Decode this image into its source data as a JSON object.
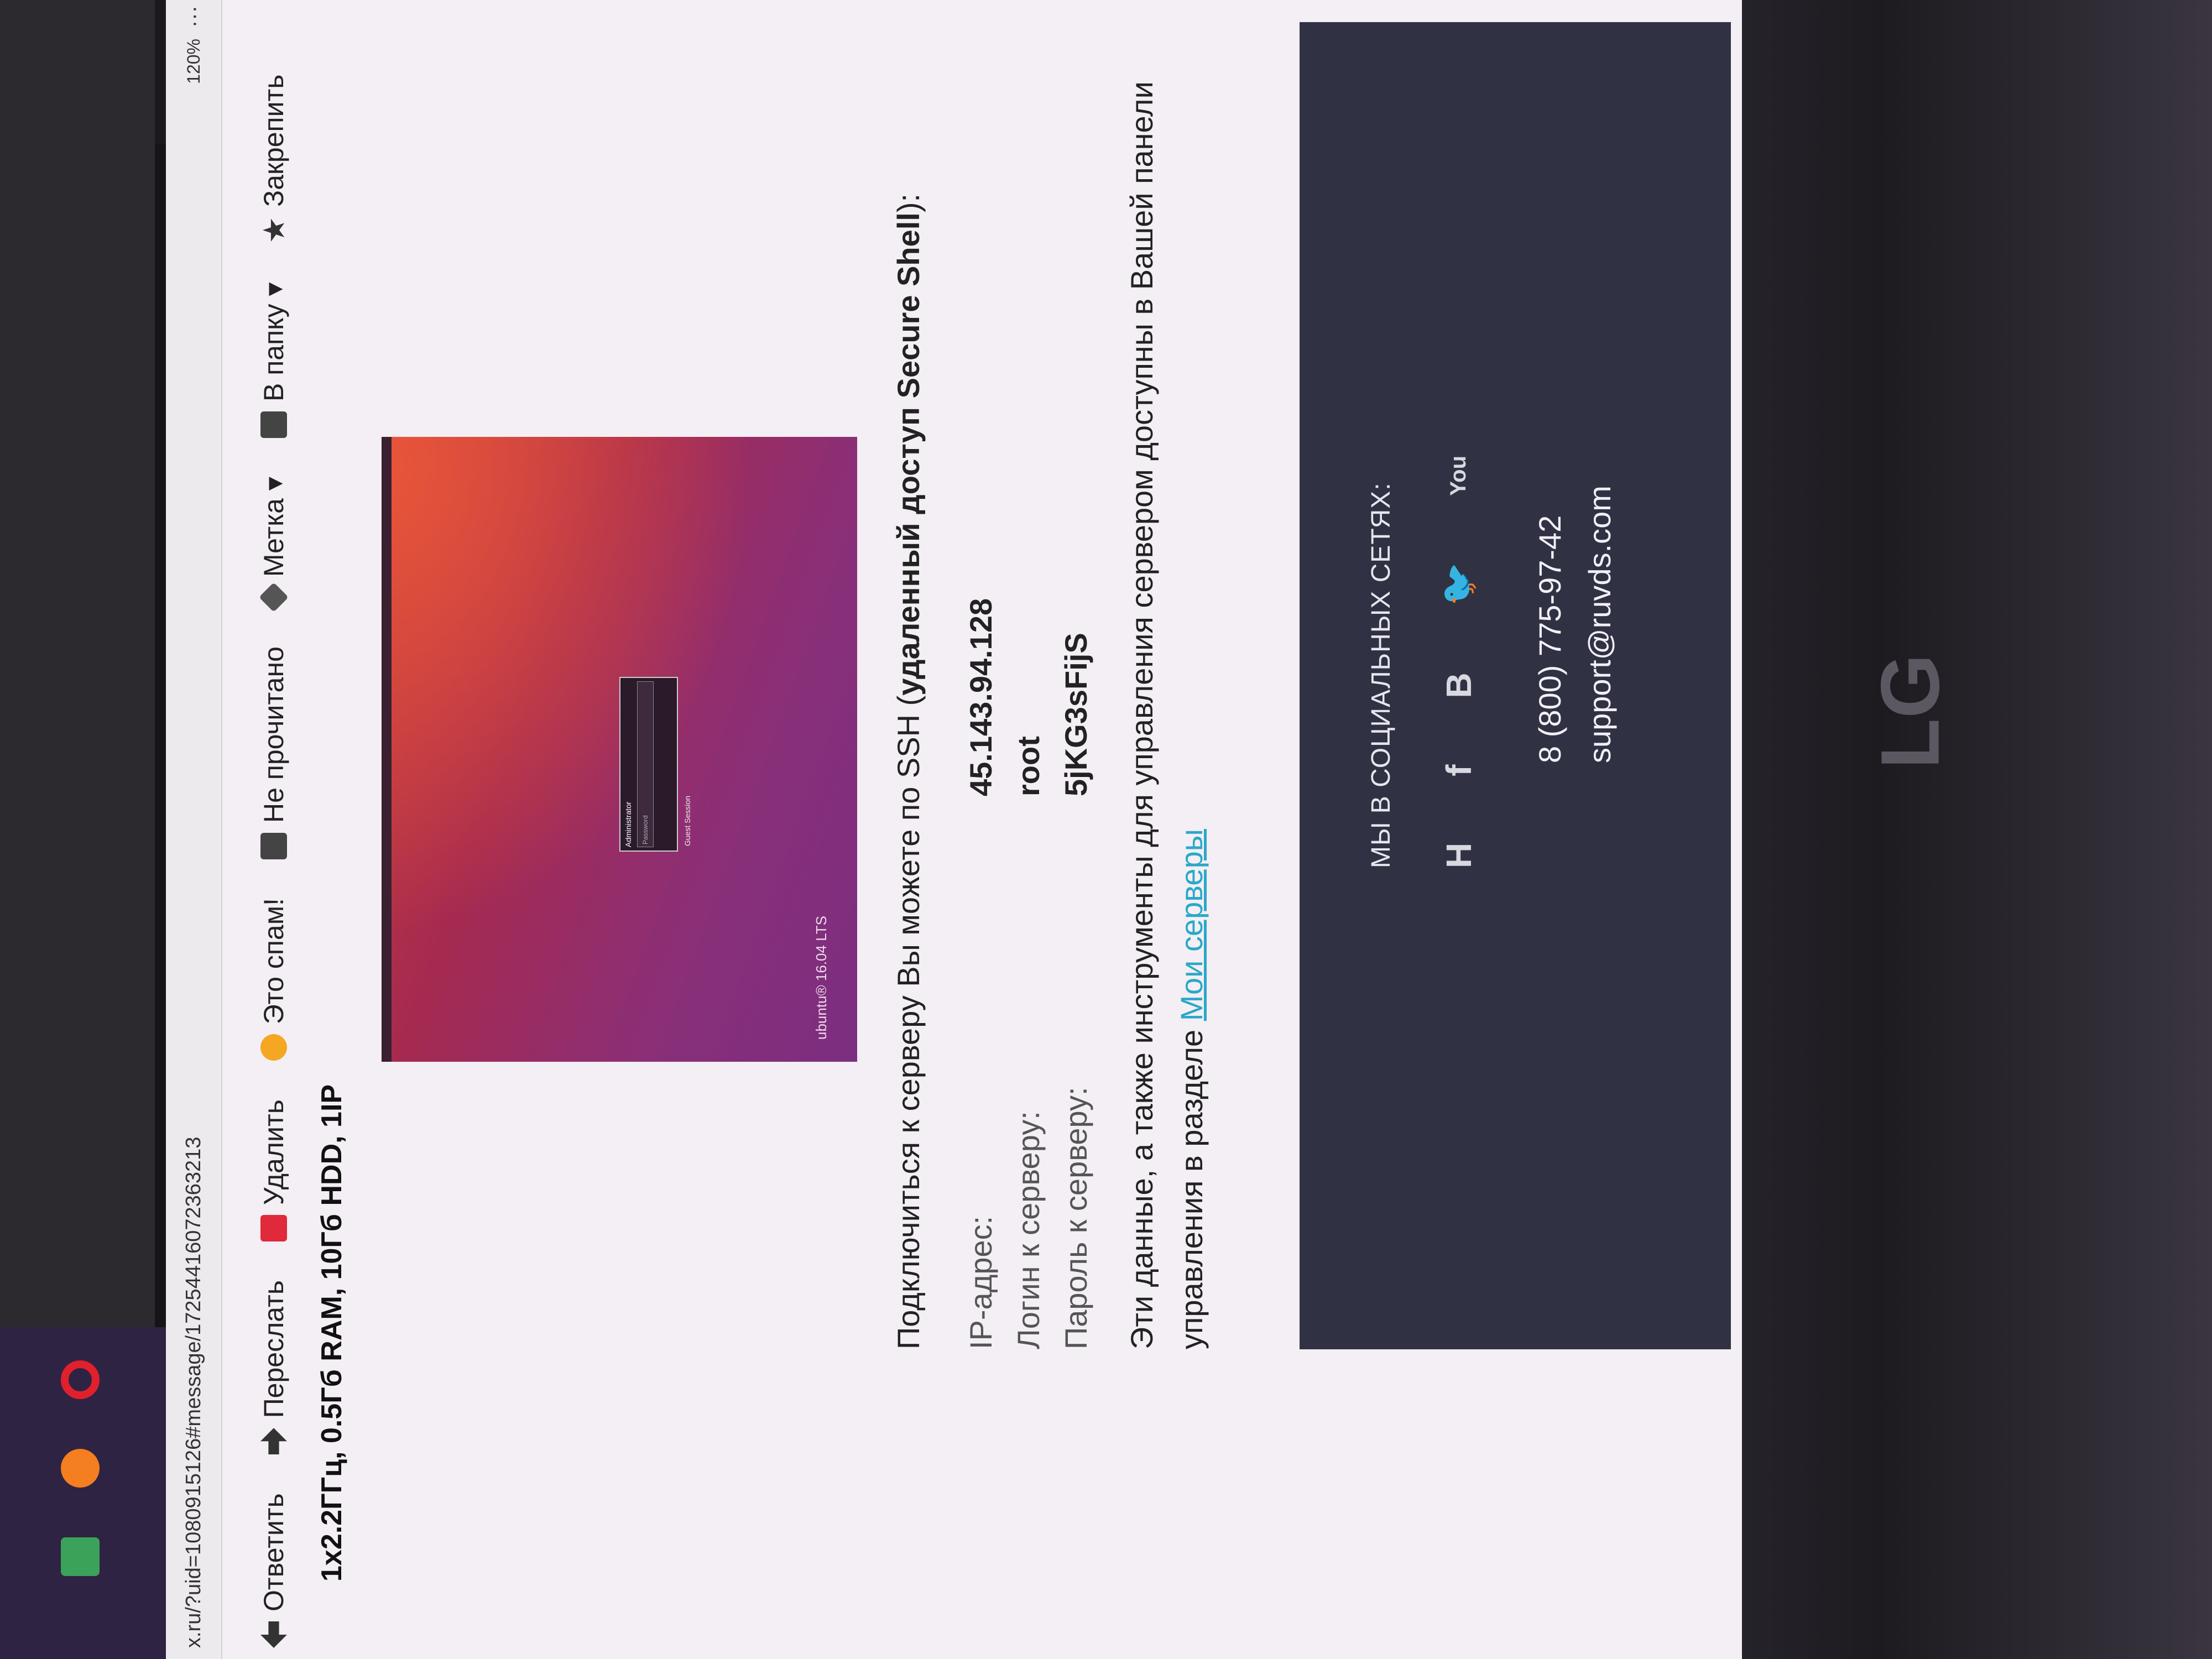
{
  "browser": {
    "url": "x.ru/?uid=1080915126#message/17254416072363213",
    "zoom": "120%",
    "more": "···"
  },
  "toolbar": {
    "reply": "Ответить",
    "forward": "Переслать",
    "delete": "Удалить",
    "spam": "Это спам!",
    "unread": "Не прочитано",
    "label": "Метка ▾",
    "folder": "В папку ▾",
    "pin": "Закрепить"
  },
  "message": {
    "subject_partial": "1x2.2ГГц, 0.5Гб RAM, 10Гб HDD, 1IP",
    "hero": {
      "login_user": "Administrator",
      "password_placeholder": "Password",
      "guest": "Guest Session",
      "brand": "ubuntu® 16.04 LTS"
    },
    "ssh_text": "Подключиться к серверу Вы можете по SSH (",
    "ssh_bold": "удаленный доступ Secure Shell",
    "ssh_end": "):",
    "credentials": [
      {
        "label": "IP-адрес:",
        "value": "45.143.94.128"
      },
      {
        "label": "Логин к серверу:",
        "value": "root"
      },
      {
        "label": "Пароль к серверу:",
        "value": "5jKG3sFijS"
      }
    ],
    "note_text": "Эти данные, а также инструменты для управления сервером доступны в Вашей панели управления в разделе ",
    "note_link": "Мои серверы"
  },
  "footer": {
    "social_title": "МЫ В СОЦИАЛЬНЫХ СЕТЯХ:",
    "social_icons": [
      "H",
      "f",
      "В",
      "twitter-icon",
      "You"
    ],
    "phone": "8 (800) 775-97-42",
    "email": "support@ruvds.com"
  },
  "device": {
    "brand": "LG"
  }
}
